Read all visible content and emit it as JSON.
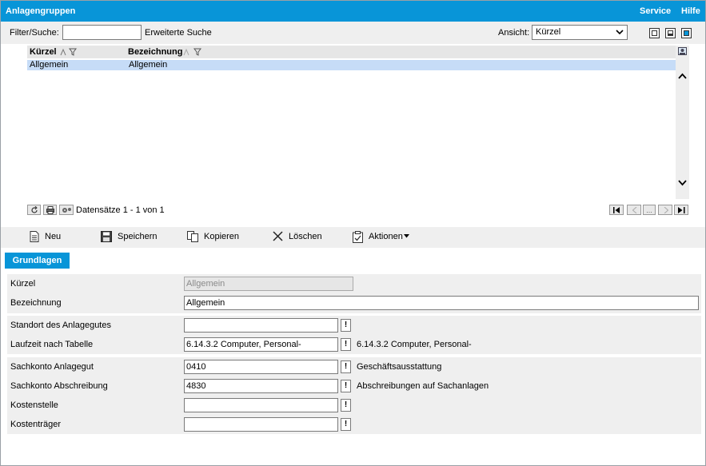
{
  "window": {
    "title": "Anlagengruppen",
    "menu_service": "Service",
    "menu_hilfe": "Hilfe"
  },
  "filter": {
    "label": "Filter/Suche:",
    "value": "",
    "extended_search": "Erweiterte Suche",
    "view_label": "Ansicht:",
    "view_selected": "Kürzel"
  },
  "grid": {
    "columns": [
      "Kürzel",
      "Bezeichnung"
    ],
    "rows": [
      {
        "kuerzel": "Allgemein",
        "bezeichnung": "Allgemein"
      }
    ],
    "records_info": "Datensätze 1 - 1 von 1",
    "page_ellipsis": "..."
  },
  "toolbar": {
    "neu": "Neu",
    "speichern": "Speichern",
    "kopieren": "Kopieren",
    "loeschen": "Löschen",
    "aktionen": "Aktionen"
  },
  "tabs": {
    "grundlagen": "Grundlagen"
  },
  "form": {
    "kuerzel_label": "Kürzel",
    "kuerzel_value": "Allgemein",
    "bezeichnung_label": "Bezeichnung",
    "bezeichnung_value": "Allgemein",
    "standort_label": "Standort des Anlagegutes",
    "standort_value": "",
    "laufzeit_label": "Laufzeit nach Tabelle",
    "laufzeit_value": "6.14.3.2 Computer, Personal-",
    "laufzeit_desc": "6.14.3.2 Computer, Personal-",
    "sachkonto_anlagegut_label": "Sachkonto Anlagegut",
    "sachkonto_anlagegut_value": "0410",
    "sachkonto_anlagegut_desc": "Geschäftsausstattung",
    "sachkonto_abschreibung_label": "Sachkonto Abschreibung",
    "sachkonto_abschreibung_value": "4830",
    "sachkonto_abschreibung_desc": "Abschreibungen auf Sachanlagen",
    "kostenstelle_label": "Kostenstelle",
    "kostenstelle_value": "",
    "kostentraeger_label": "Kostenträger",
    "kostentraeger_value": "",
    "lookup_symbol": "!"
  },
  "colors": {
    "accent": "#0895d8",
    "selection": "#c6dcf7",
    "panel": "#efefef"
  }
}
